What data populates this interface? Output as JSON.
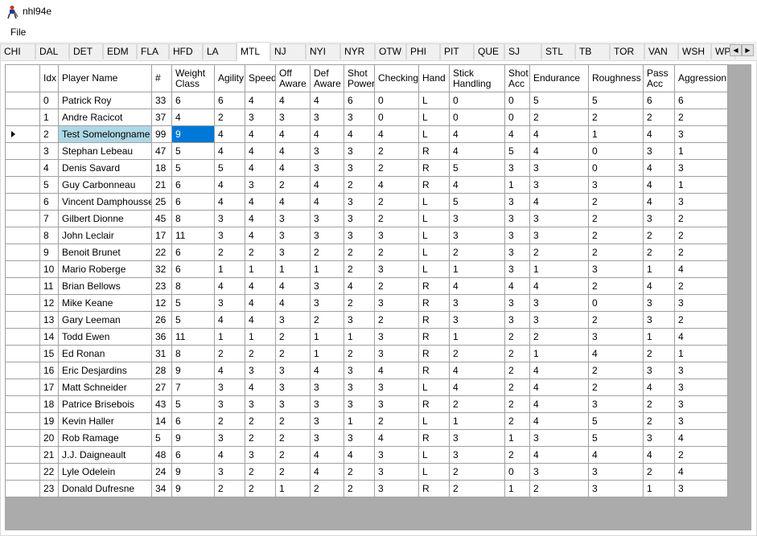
{
  "window": {
    "title": "nhl94e"
  },
  "menu": {
    "file": "File"
  },
  "tabs": [
    "CHI",
    "DAL",
    "DET",
    "EDM",
    "FLA",
    "HFD",
    "LA",
    "MTL",
    "NJ",
    "NYI",
    "NYR",
    "OTW",
    "PHI",
    "PIT",
    "QUE",
    "SJ",
    "STL",
    "TB",
    "TOR",
    "VAN",
    "WSH",
    "WPG"
  ],
  "active_tab": "MTL",
  "columns": [
    "Idx",
    "Player Name",
    "#",
    "Weight Class",
    "Agility",
    "Speed",
    "Off Aware",
    "Def Aware",
    "Shot Power",
    "Checking",
    "Hand",
    "Stick Handling",
    "Shot Acc",
    "Endurance",
    "Roughness",
    "Pass Acc",
    "Aggression"
  ],
  "rows": [
    [
      "0",
      "Patrick Roy",
      "33",
      "6",
      "6",
      "4",
      "4",
      "4",
      "6",
      "0",
      "L",
      "0",
      "0",
      "5",
      "5",
      "6",
      "6"
    ],
    [
      "1",
      "Andre Racicot",
      "37",
      "4",
      "2",
      "3",
      "3",
      "3",
      "3",
      "0",
      "L",
      "0",
      "0",
      "2",
      "2",
      "2",
      "2"
    ],
    [
      "2",
      "Test Somelongname",
      "99",
      "9",
      "4",
      "4",
      "4",
      "4",
      "4",
      "4",
      "L",
      "4",
      "4",
      "4",
      "1",
      "4",
      "3"
    ],
    [
      "3",
      "Stephan Lebeau",
      "47",
      "5",
      "4",
      "4",
      "4",
      "3",
      "3",
      "2",
      "R",
      "4",
      "5",
      "4",
      "0",
      "3",
      "1"
    ],
    [
      "4",
      "Denis Savard",
      "18",
      "5",
      "5",
      "4",
      "4",
      "3",
      "3",
      "2",
      "R",
      "5",
      "3",
      "3",
      "0",
      "4",
      "3"
    ],
    [
      "5",
      "Guy Carbonneau",
      "21",
      "6",
      "4",
      "3",
      "2",
      "4",
      "2",
      "4",
      "R",
      "4",
      "1",
      "3",
      "3",
      "4",
      "1"
    ],
    [
      "6",
      "Vincent Damphousse",
      "25",
      "6",
      "4",
      "4",
      "4",
      "4",
      "3",
      "2",
      "L",
      "5",
      "3",
      "4",
      "2",
      "4",
      "3"
    ],
    [
      "7",
      "Gilbert Dionne",
      "45",
      "8",
      "3",
      "4",
      "3",
      "3",
      "3",
      "2",
      "L",
      "3",
      "3",
      "3",
      "2",
      "3",
      "2"
    ],
    [
      "8",
      "John Leclair",
      "17",
      "11",
      "3",
      "4",
      "3",
      "3",
      "3",
      "3",
      "L",
      "3",
      "3",
      "3",
      "2",
      "2",
      "2"
    ],
    [
      "9",
      "Benoit Brunet",
      "22",
      "6",
      "2",
      "2",
      "3",
      "2",
      "2",
      "2",
      "L",
      "2",
      "3",
      "2",
      "2",
      "2",
      "2"
    ],
    [
      "10",
      "Mario Roberge",
      "32",
      "6",
      "1",
      "1",
      "1",
      "1",
      "2",
      "3",
      "L",
      "1",
      "3",
      "1",
      "3",
      "1",
      "4"
    ],
    [
      "11",
      "Brian Bellows",
      "23",
      "8",
      "4",
      "4",
      "4",
      "3",
      "4",
      "2",
      "R",
      "4",
      "4",
      "4",
      "2",
      "4",
      "2"
    ],
    [
      "12",
      "Mike Keane",
      "12",
      "5",
      "3",
      "4",
      "4",
      "3",
      "2",
      "3",
      "R",
      "3",
      "3",
      "3",
      "0",
      "3",
      "3"
    ],
    [
      "13",
      "Gary Leeman",
      "26",
      "5",
      "4",
      "4",
      "3",
      "2",
      "3",
      "2",
      "R",
      "3",
      "3",
      "3",
      "2",
      "3",
      "2"
    ],
    [
      "14",
      "Todd Ewen",
      "36",
      "11",
      "1",
      "1",
      "2",
      "1",
      "1",
      "3",
      "R",
      "1",
      "2",
      "2",
      "3",
      "1",
      "4"
    ],
    [
      "15",
      "Ed Ronan",
      "31",
      "8",
      "2",
      "2",
      "2",
      "1",
      "2",
      "3",
      "R",
      "2",
      "2",
      "1",
      "4",
      "2",
      "1"
    ],
    [
      "16",
      "Eric Desjardins",
      "28",
      "9",
      "4",
      "3",
      "3",
      "4",
      "3",
      "4",
      "R",
      "4",
      "2",
      "4",
      "2",
      "3",
      "3"
    ],
    [
      "17",
      "Matt Schneider",
      "27",
      "7",
      "3",
      "4",
      "3",
      "3",
      "3",
      "3",
      "L",
      "4",
      "2",
      "4",
      "2",
      "4",
      "3"
    ],
    [
      "18",
      "Patrice Brisebois",
      "43",
      "5",
      "3",
      "3",
      "3",
      "3",
      "3",
      "3",
      "R",
      "2",
      "2",
      "4",
      "3",
      "2",
      "3"
    ],
    [
      "19",
      "Kevin Haller",
      "14",
      "6",
      "2",
      "2",
      "2",
      "3",
      "1",
      "2",
      "L",
      "1",
      "2",
      "4",
      "5",
      "2",
      "3"
    ],
    [
      "20",
      "Rob Ramage",
      "5",
      "9",
      "3",
      "2",
      "2",
      "3",
      "3",
      "4",
      "R",
      "3",
      "1",
      "3",
      "5",
      "3",
      "4"
    ],
    [
      "21",
      "J.J. Daigneault",
      "48",
      "6",
      "4",
      "3",
      "2",
      "4",
      "4",
      "3",
      "L",
      "3",
      "2",
      "4",
      "4",
      "4",
      "2"
    ],
    [
      "22",
      "Lyle Odelein",
      "24",
      "9",
      "3",
      "2",
      "2",
      "4",
      "2",
      "3",
      "L",
      "2",
      "0",
      "3",
      "3",
      "2",
      "4"
    ],
    [
      "23",
      "Donald Dufresne",
      "34",
      "9",
      "2",
      "2",
      "1",
      "2",
      "2",
      "3",
      "R",
      "2",
      "1",
      "2",
      "3",
      "1",
      "3"
    ]
  ],
  "selected_row": 2
}
